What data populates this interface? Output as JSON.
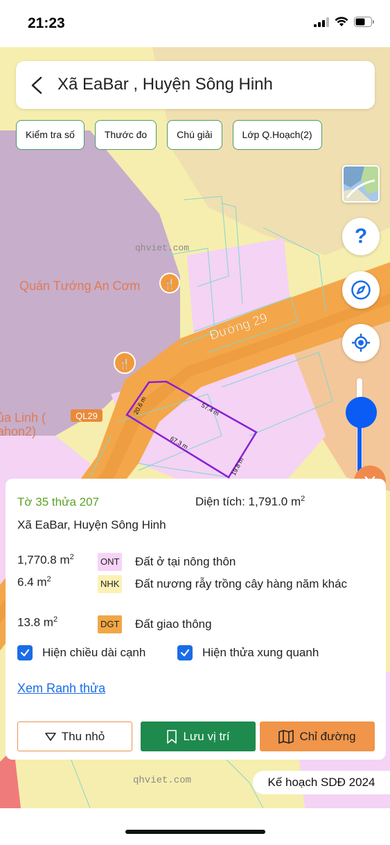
{
  "status": {
    "time": "21:23"
  },
  "header": {
    "title": "Xã EaBar , Huyện Sông Hinh"
  },
  "chips": [
    {
      "label": "Kiểm tra số"
    },
    {
      "label": "Thước đo"
    },
    {
      "label": "Chú giải"
    },
    {
      "label": "Lớp Q.Hoạch(2)"
    }
  ],
  "map": {
    "watermark": "qhviet.com",
    "poi_label": "Quán Tướng An Cơm",
    "road_label": "Đường 29",
    "route_badge": "QL29",
    "partial_label_1": "ủa Linh (",
    "partial_label_2": "ahon2)",
    "edges": {
      "top": "57.4 m",
      "left": "20.6 m",
      "bottom": "67.3 m",
      "right": "19.8 m"
    },
    "zoom_level": 0.72
  },
  "parcel": {
    "sheet": "Tờ 35 thửa 207",
    "area_label": "Diện tích: 1,791.0 m",
    "area_sup": "2",
    "location": "Xã EaBar, Huyện Sông Hinh",
    "landuse": [
      {
        "amount": "1,770.8 m",
        "sup": "2",
        "code": "ONT",
        "code_bg": "#f7d3f7",
        "desc": "Đất ở tại nông thôn"
      },
      {
        "amount": "6.4 m",
        "sup": "2",
        "code": "NHK",
        "code_bg": "#fbf1b6",
        "desc": "Đất nương rẫy trồng cây hàng năm khác"
      },
      {
        "amount": "13.8 m",
        "sup": "2",
        "code": "DGT",
        "code_bg": "#f2a646",
        "desc": "Đất giao thông"
      }
    ],
    "show_edge_lengths": "Hiện chiều dài cạnh",
    "show_neighbors": "Hiện thửa xung quanh",
    "view_boundary": "Xem Ranh thửa"
  },
  "actions": {
    "collapse": "Thu nhỏ",
    "save": "Lưu vị trí",
    "route": "Chỉ đường"
  },
  "plan_badge": "Kế hoạch SDĐ 2024",
  "colors": {
    "accent_blue": "#0a5cf5",
    "green": "#1e8a4e",
    "orange": "#f0954a",
    "road": "#f3a74a"
  }
}
